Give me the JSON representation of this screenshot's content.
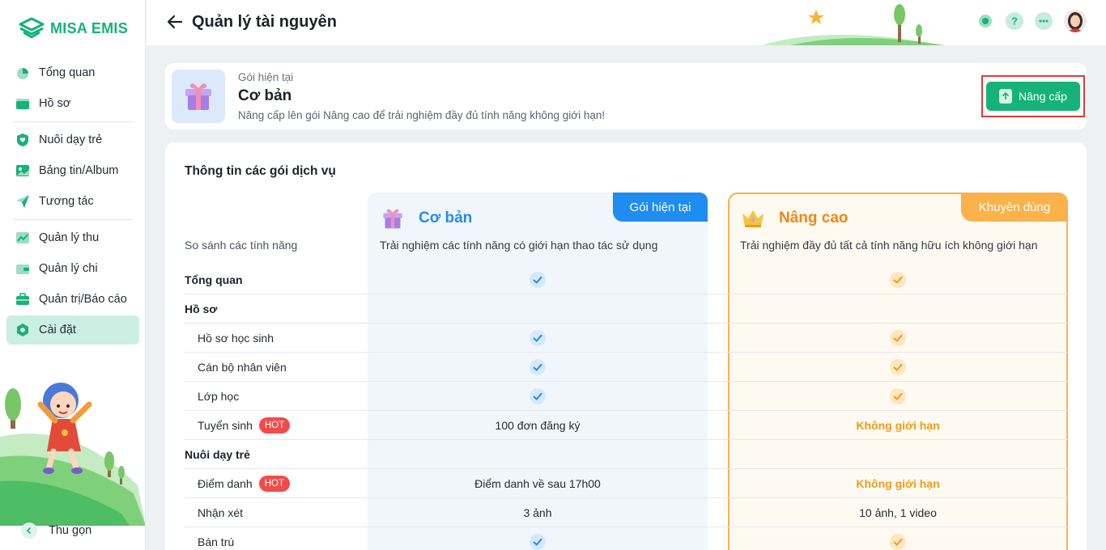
{
  "app": {
    "brand": "MISA EMIS",
    "accent": "#16b27a"
  },
  "sidebar": {
    "items": [
      {
        "label": "Tổng quan",
        "icon": "pie-chart-icon"
      },
      {
        "label": "Hồ sơ",
        "icon": "folder-icon"
      },
      {
        "label": "Nuôi dạy trẻ",
        "icon": "heart-shield-icon"
      },
      {
        "label": "Bảng tin/Album",
        "icon": "image-icon"
      },
      {
        "label": "Tương tác",
        "icon": "paper-plane-icon"
      },
      {
        "label": "Quản lý thu",
        "icon": "chart-line-icon"
      },
      {
        "label": "Quản lý chi",
        "icon": "wallet-icon"
      },
      {
        "label": "Quản trị/Báo cáo",
        "icon": "briefcase-icon"
      },
      {
        "label": "Cài đặt",
        "icon": "settings-hex-icon",
        "active": true
      }
    ],
    "collapse_label": "Thu gọn"
  },
  "header": {
    "title": "Quản lý tài nguyên"
  },
  "current_plan": {
    "caption": "Gói hiện tại",
    "name": "Cơ bản",
    "description": "Nâng cấp lên gói Nâng cao để trải nghiệm đầy đủ tính năng không giới hạn!",
    "upgrade_label": "Nâng cấp"
  },
  "plans_section": {
    "title": "Thông tin các gói dịch vụ",
    "compare_label": "So sánh các tính năng",
    "basic": {
      "name": "Cơ bản",
      "badge": "Gói hiện tại",
      "description": "Trải nghiệm các tính năng có giới hạn thao tác sử dụng",
      "color": "#1f8df0"
    },
    "advanced": {
      "name": "Nâng cao",
      "badge": "Khuyên dùng",
      "description": "Trải nghiệm đầy đủ tất cả tính năng hữu ích không giới hạn",
      "color": "#f0880f"
    },
    "rows": [
      {
        "feature": "Tổng quan",
        "group": true,
        "basic": "check",
        "advanced": "check"
      },
      {
        "feature": "Hồ sơ",
        "group": true,
        "basic": "",
        "advanced": ""
      },
      {
        "feature": "Hồ sơ học sinh",
        "basic": "check",
        "advanced": "check"
      },
      {
        "feature": "Cán bộ nhân viên",
        "basic": "check",
        "advanced": "check"
      },
      {
        "feature": "Lớp học",
        "basic": "check",
        "advanced": "check"
      },
      {
        "feature": "Tuyển sinh",
        "hot": "HOT",
        "basic": "100 đơn đăng ký",
        "advanced": "Không giới hạn",
        "advanced_strong": true
      },
      {
        "feature": "Nuôi dạy trẻ",
        "group": true,
        "basic": "",
        "advanced": ""
      },
      {
        "feature": "Điểm danh",
        "hot": "HOT",
        "basic": "Điểm danh về sau 17h00",
        "advanced": "Không giới hạn",
        "advanced_strong": true
      },
      {
        "feature": "Nhận xét",
        "basic": "3 ảnh",
        "advanced": "10 ảnh, 1 video"
      },
      {
        "feature": "Bán trú",
        "basic": "check",
        "advanced": "check"
      }
    ]
  }
}
